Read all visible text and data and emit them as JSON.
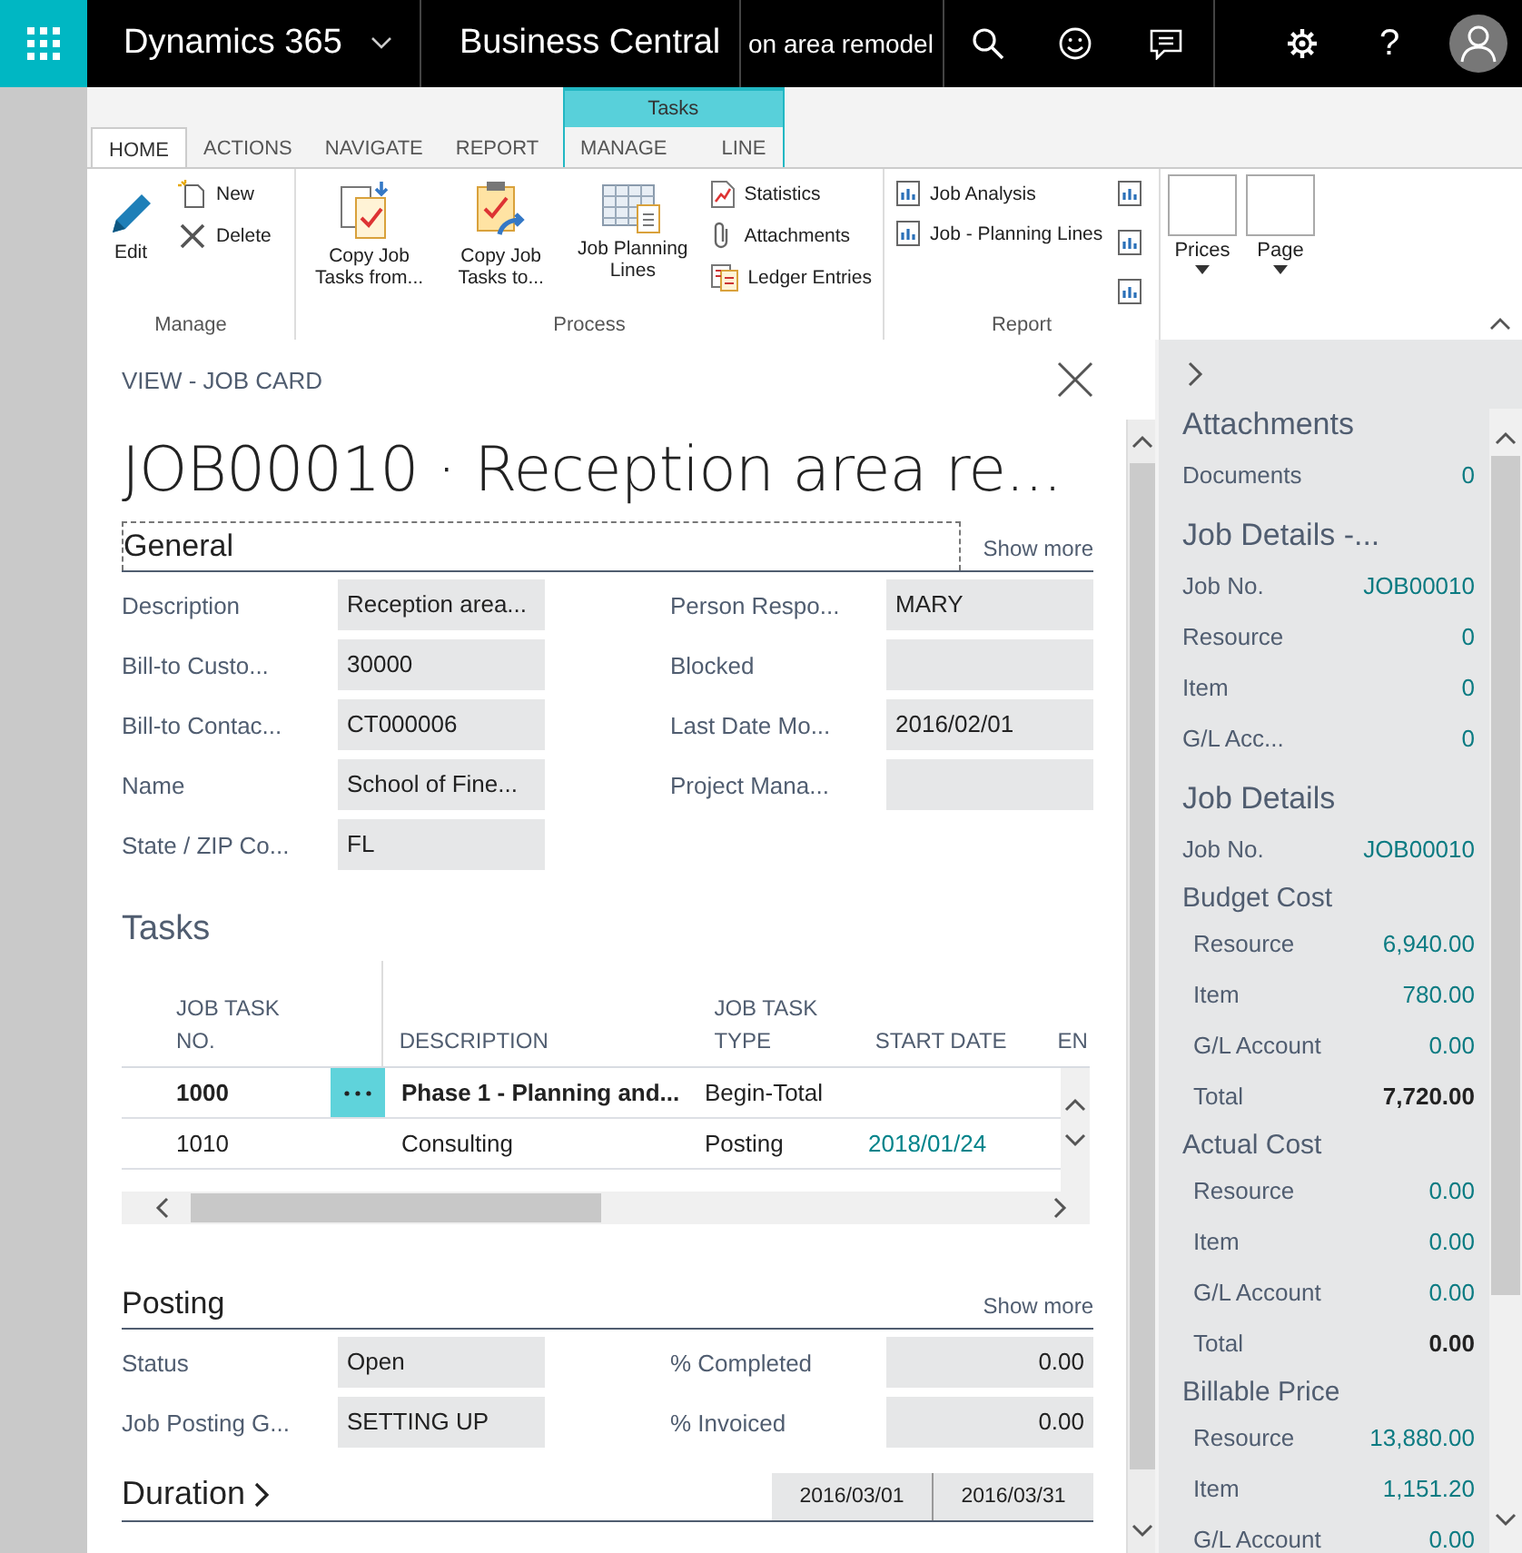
{
  "top_bar": {
    "product": "Dynamics 365",
    "app": "Business Central",
    "page_title": "on area remodel",
    "help": "?"
  },
  "ribbon": {
    "tabs": [
      {
        "label": "HOME",
        "selected": true
      },
      {
        "label": "ACTIONS",
        "selected": false
      },
      {
        "label": "NAVIGATE",
        "selected": false
      },
      {
        "label": "REPORT",
        "selected": false
      }
    ],
    "context": {
      "title": "Tasks",
      "tabs": [
        {
          "label": "MANAGE",
          "selected": false
        },
        {
          "label": "LINE",
          "selected": false
        }
      ]
    },
    "groups": [
      {
        "title": "Manage",
        "large": [
          {
            "label": "Edit"
          }
        ],
        "small": [
          {
            "label": "New"
          },
          {
            "label": "Delete"
          }
        ]
      },
      {
        "title": "Process",
        "large": [
          {
            "label": "Copy Job Tasks from..."
          },
          {
            "label": "Copy Job Tasks to..."
          },
          {
            "label": "Job Planning Lines"
          }
        ],
        "small": [
          {
            "label": "Statistics"
          },
          {
            "label": "Attachments"
          },
          {
            "label": "Ledger Entries"
          }
        ]
      },
      {
        "title": "Report",
        "small": [
          {
            "label": "Job Analysis"
          },
          {
            "label": "Job - Planning Lines"
          }
        ]
      }
    ],
    "menus": [
      {
        "label": "Prices"
      },
      {
        "label": "Page"
      }
    ]
  },
  "card": {
    "caption": "VIEW - JOB CARD",
    "title": "JOB00010 · Reception area re...",
    "general": {
      "title": "General",
      "show_more": "Show more",
      "left_fields": [
        {
          "label": "Description",
          "value": "Reception area..."
        },
        {
          "label": "Bill-to Custo...",
          "value": "30000"
        },
        {
          "label": "Bill-to Contac...",
          "value": "CT000006"
        },
        {
          "label": "Name",
          "value": "School of Fine..."
        },
        {
          "label": "State / ZIP Co...",
          "value": "FL"
        }
      ],
      "right_fields": [
        {
          "label": "Person Respo...",
          "value": "MARY"
        },
        {
          "label": "Blocked"
        },
        {
          "label": "Last Date Mo...",
          "value": "2016/02/01"
        },
        {
          "label": "Project Mana..."
        }
      ]
    },
    "tasks": {
      "title": "Tasks",
      "columns": [
        "JOB TASK NO.",
        "DESCRIPTION",
        "JOB TASK TYPE",
        "START DATE",
        "EN"
      ],
      "rows": [
        {
          "no": "1000",
          "description": "Phase 1 - Planning and...",
          "type": "Begin-Total",
          "bold": true,
          "selected": true
        },
        {
          "no": "1010",
          "description": "Consulting",
          "type": "Posting",
          "start": "2018/01/24",
          "bold": false,
          "selected": false
        }
      ]
    },
    "posting": {
      "title": "Posting",
      "show_more": "Show more",
      "left_fields": [
        {
          "label": "Status",
          "value": "Open"
        },
        {
          "label": "Job Posting G...",
          "value": "SETTING UP"
        }
      ],
      "right_fields": [
        {
          "label": "% Completed",
          "value": "0.00",
          "numeric": true
        },
        {
          "label": "% Invoiced",
          "value": "0.00",
          "numeric": true
        }
      ]
    },
    "duration": {
      "title": "Duration",
      "dates": [
        "2016/03/01",
        "2016/03/31"
      ]
    }
  },
  "factbox": {
    "sections": [
      {
        "title": "Attachments",
        "rows": [
          {
            "label": "Documents",
            "value": "0",
            "kind": "link"
          }
        ]
      },
      {
        "title": "Job Details -...",
        "rows": [
          {
            "label": "Job No.",
            "value": "JOB00010",
            "kind": "link"
          },
          {
            "label": "Resource",
            "value": "0",
            "kind": "link"
          },
          {
            "label": "Item",
            "value": "0",
            "kind": "link"
          },
          {
            "label": "G/L Acc...",
            "value": "0",
            "kind": "link"
          }
        ]
      },
      {
        "title": "Job Details",
        "rows": [
          {
            "label": "Job No.",
            "value": "JOB00010",
            "kind": "link"
          }
        ],
        "groups": [
          {
            "title": "Budget Cost",
            "rows": [
              {
                "label": "Resource",
                "value": "6,940.00",
                "kind": "link"
              },
              {
                "label": "Item",
                "value": "780.00",
                "kind": "link"
              },
              {
                "label": "G/L Account",
                "value": "0.00",
                "kind": "link"
              },
              {
                "label": "Total",
                "value": "7,720.00",
                "kind": "total"
              }
            ]
          },
          {
            "title": "Actual Cost",
            "rows": [
              {
                "label": "Resource",
                "value": "0.00",
                "kind": "link"
              },
              {
                "label": "Item",
                "value": "0.00",
                "kind": "link"
              },
              {
                "label": "G/L Account",
                "value": "0.00",
                "kind": "link"
              },
              {
                "label": "Total",
                "value": "0.00",
                "kind": "total"
              }
            ]
          },
          {
            "title": "Billable Price",
            "rows": [
              {
                "label": "Resource",
                "value": "13,880.00",
                "kind": "link"
              },
              {
                "label": "Item",
                "value": "1,151.20",
                "kind": "link"
              },
              {
                "label": "G/L Account",
                "value": "0.00",
                "kind": "link"
              }
            ]
          }
        ]
      }
    ]
  }
}
